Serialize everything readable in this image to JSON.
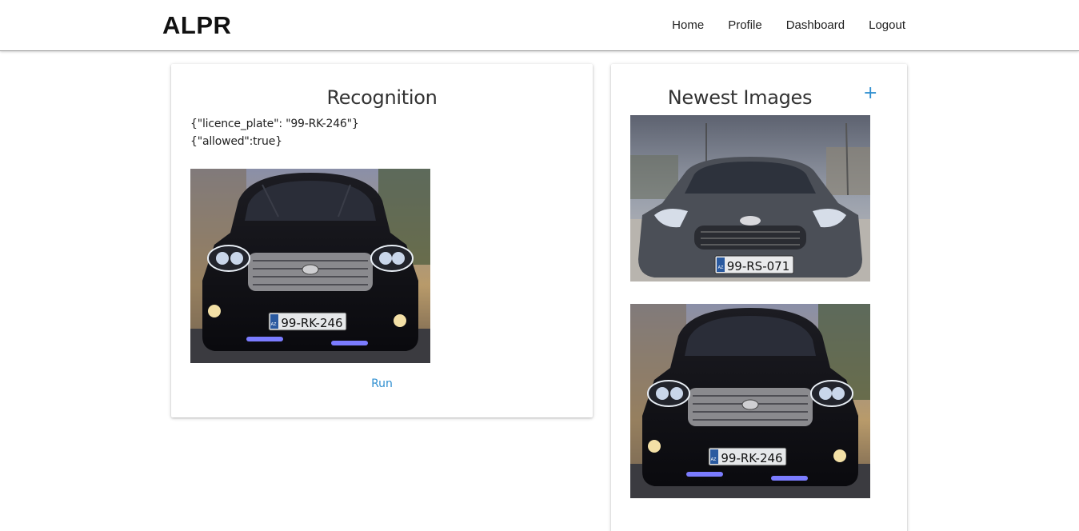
{
  "header": {
    "brand": "ALPR",
    "nav": [
      {
        "label": "Home"
      },
      {
        "label": "Profile"
      },
      {
        "label": "Dashboard"
      },
      {
        "label": "Logout"
      }
    ]
  },
  "recognition": {
    "title": "Recognition",
    "result_line_1": "{\"licence_plate\": \"99-RK-246\"}",
    "result_line_2": "{\"allowed\":true}",
    "image": {
      "plate_text": "99-RK-246",
      "plate_prefix": "AZ",
      "icon": "car-photo"
    },
    "run_label": "Run"
  },
  "newest": {
    "title": "Newest Images",
    "add_label": "+",
    "images": [
      {
        "plate_text": "99-RS-071",
        "plate_prefix": "AZ",
        "icon": "car-photo"
      },
      {
        "plate_text": "99-RK-246",
        "plate_prefix": "AZ",
        "icon": "car-photo"
      }
    ]
  },
  "colors": {
    "accent": "#2f8fd0",
    "text": "#222222",
    "nav_border": "#9a9a9a"
  }
}
